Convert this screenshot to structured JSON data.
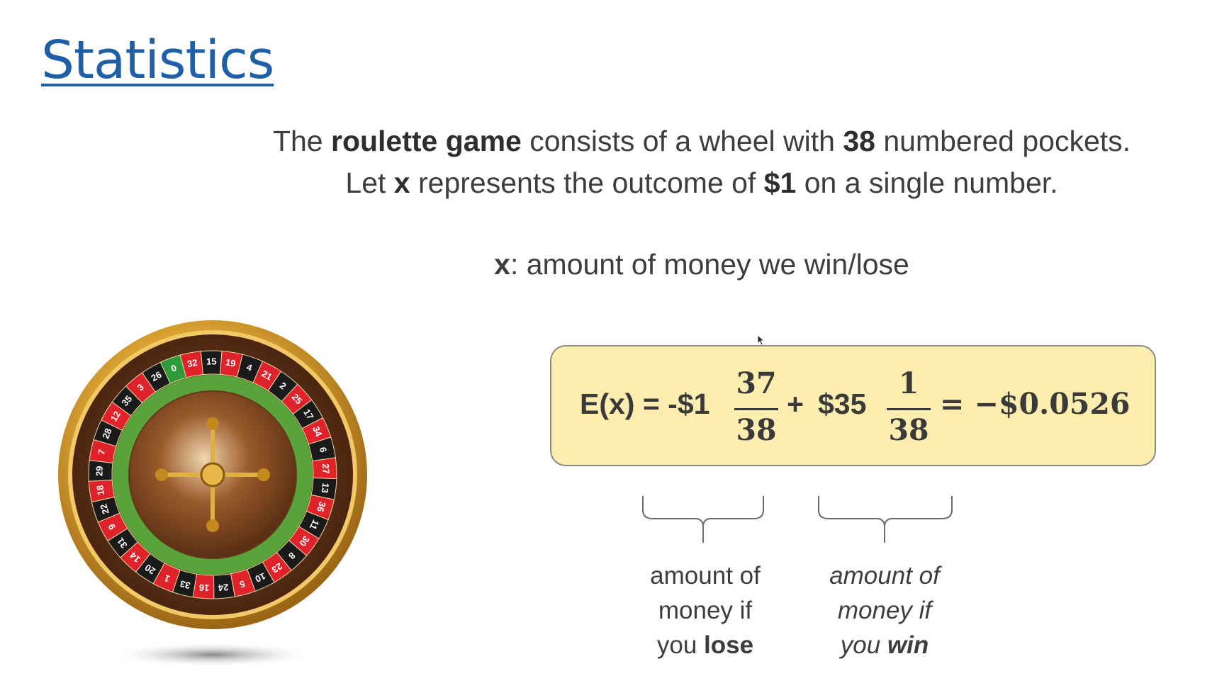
{
  "slide": {
    "title": "Statistics",
    "intro_line1": {
      "t1": "The ",
      "b1": "roulette game",
      "t2": " consists of a wheel with ",
      "b2": "38",
      "t3": " numbered pockets."
    },
    "intro_line2": {
      "t1": "Let ",
      "b1": "x",
      "t2": " represents the outcome of ",
      "b2": "$1",
      "t3": " on a single number."
    },
    "definition": {
      "var": "x",
      "text": ": amount of money we win/lose"
    }
  },
  "formula": {
    "lhs": "E(x) = -$1",
    "frac1_num": "37",
    "frac1_den": "38",
    "plus": "+",
    "amount2": "$35",
    "frac2_num": "1",
    "frac2_den": "38",
    "result": "= −$0.0526"
  },
  "captions": {
    "lose": {
      "line1": "amount of",
      "line2": "money if",
      "line3_prefix": "you ",
      "line3_bold": "lose"
    },
    "win": {
      "line1": "amount of",
      "line2": "money if",
      "line3_prefix": "you ",
      "line3_bold": "win"
    }
  },
  "wheel": {
    "pockets": [
      "0",
      "32",
      "15",
      "19",
      "4",
      "21",
      "2",
      "25",
      "17",
      "34",
      "6",
      "27",
      "13",
      "36",
      "11",
      "30",
      "8",
      "23",
      "10",
      "5",
      "24",
      "16",
      "33",
      "1",
      "20",
      "14",
      "31",
      "9",
      "22",
      "18",
      "29",
      "7",
      "28",
      "12",
      "35",
      "3",
      "26"
    ],
    "pocket_colors": {
      "green": "#2f9a3a",
      "red": "#e0232b",
      "black": "#1a1a1a"
    }
  },
  "colors": {
    "title": "#1f5fa8",
    "formula_box": "#fdeeb0",
    "wheel_rim": "#c8912a",
    "wheel_wood": "#6b3a1b"
  }
}
